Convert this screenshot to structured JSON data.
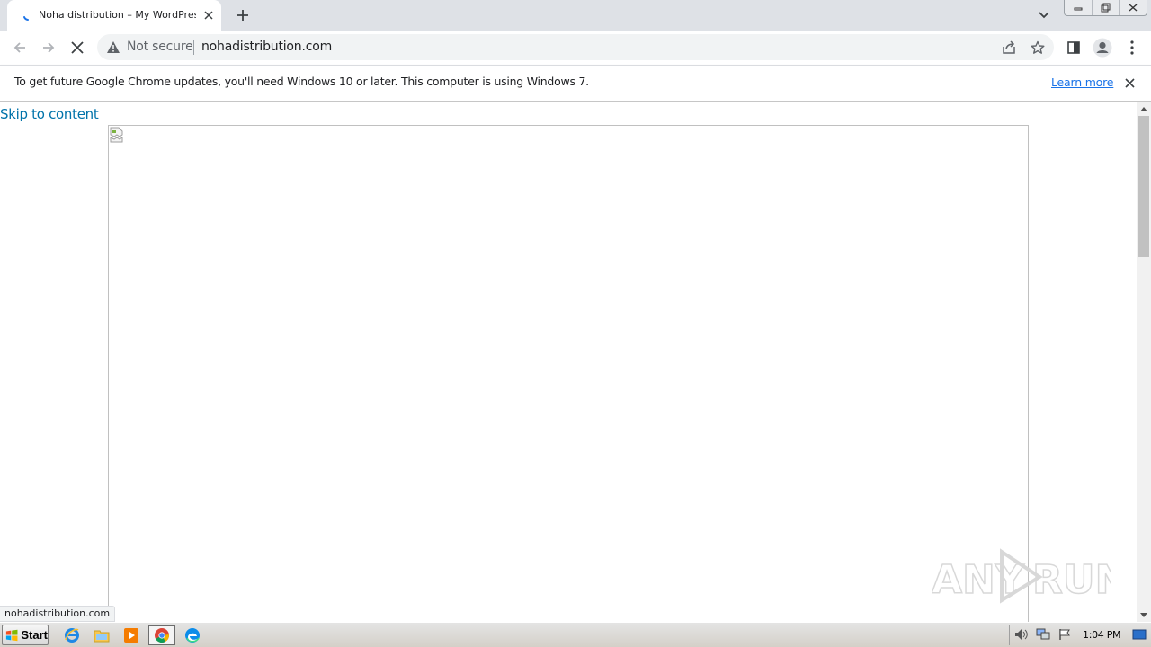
{
  "browser": {
    "tab": {
      "title": "Noha distribution – My WordPress Bl",
      "loading": true
    },
    "omnibox": {
      "security_label": "Not secure",
      "url": "nohadistribution.com"
    },
    "infobar": {
      "message": "To get future Google Chrome updates, you'll need Windows 10 or later. This computer is using Windows 7.",
      "link_label": "Learn more"
    },
    "status_bubble": "nohadistribution.com"
  },
  "page": {
    "skip_link": "Skip to content"
  },
  "watermark": {
    "text_left": "ANY",
    "text_right": "RUN"
  },
  "taskbar": {
    "start_label": "Start",
    "apps": [
      "internet-explorer-icon",
      "file-explorer-icon",
      "media-player-icon",
      "chrome-icon",
      "edge-icon"
    ],
    "clock": "1:04 PM"
  },
  "colors": {
    "tabstrip": "#dee1e6",
    "link": "#0073aa",
    "learn_more": "#1a73e8"
  }
}
